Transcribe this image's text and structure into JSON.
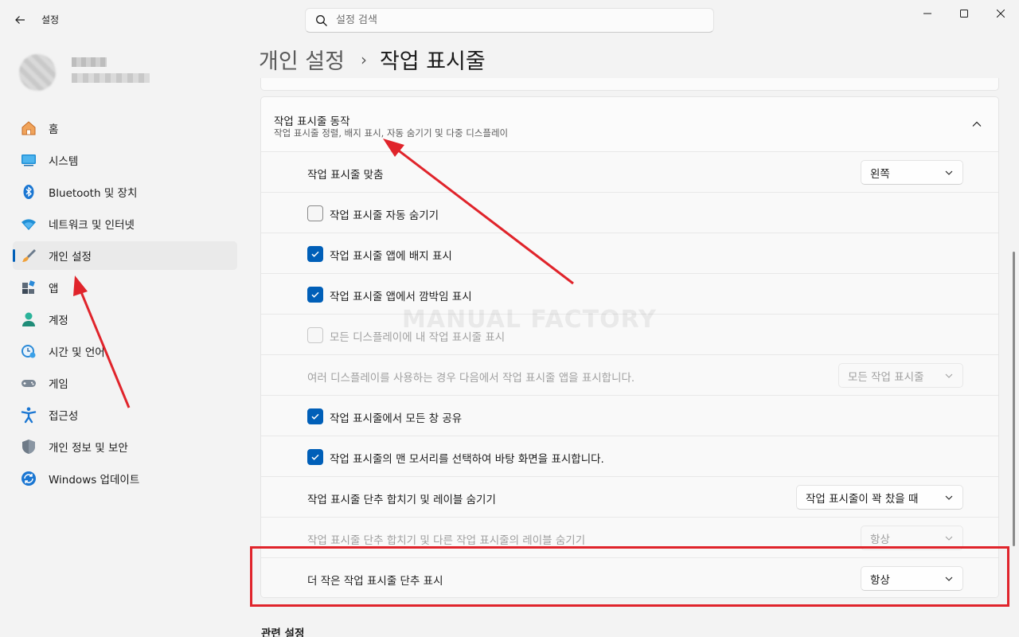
{
  "window": {
    "title": "설정",
    "controls": [
      "minimize",
      "maximize",
      "close"
    ]
  },
  "search": {
    "placeholder": "설정 검색"
  },
  "sidebar": {
    "items": [
      {
        "label": "홈",
        "icon": "home-icon",
        "active": false
      },
      {
        "label": "시스템",
        "icon": "system-icon",
        "active": false
      },
      {
        "label": "Bluetooth 및 장치",
        "icon": "bluetooth-icon",
        "active": false
      },
      {
        "label": "네트워크 및 인터넷",
        "icon": "wifi-icon",
        "active": false
      },
      {
        "label": "개인 설정",
        "icon": "brush-icon",
        "active": true
      },
      {
        "label": "앱",
        "icon": "apps-icon",
        "active": false
      },
      {
        "label": "계정",
        "icon": "account-icon",
        "active": false
      },
      {
        "label": "시간 및 언어",
        "icon": "time-language-icon",
        "active": false
      },
      {
        "label": "게임",
        "icon": "gamepad-icon",
        "active": false
      },
      {
        "label": "접근성",
        "icon": "accessibility-icon",
        "active": false
      },
      {
        "label": "개인 정보 및 보안",
        "icon": "shield-icon",
        "active": false
      },
      {
        "label": "Windows 업데이트",
        "icon": "update-icon",
        "active": false
      }
    ]
  },
  "breadcrumb": {
    "parent": "개인 설정",
    "separator": "›",
    "current": "작업 표시줄"
  },
  "section": {
    "title": "작업 표시줄 동작",
    "subtitle": "작업 표시줄 정렬, 배지 표시, 자동 숨기기 및 다중 디스플레이",
    "rows": [
      {
        "type": "dropdown",
        "label": "작업 표시줄 맞춤",
        "value": "왼쪽",
        "disabled": false
      },
      {
        "type": "checkbox",
        "label": "작업 표시줄 자동 숨기기",
        "checked": false,
        "disabled": false
      },
      {
        "type": "checkbox",
        "label": "작업 표시줄 앱에 배지 표시",
        "checked": true,
        "disabled": false
      },
      {
        "type": "checkbox",
        "label": "작업 표시줄 앱에서 깜박임 표시",
        "checked": true,
        "disabled": false
      },
      {
        "type": "checkbox",
        "label": "모든 디스플레이에 내 작업 표시줄 표시",
        "checked": false,
        "disabled": true
      },
      {
        "type": "dropdown",
        "label": "여러 디스플레이를 사용하는 경우 다음에서 작업 표시줄 앱을 표시합니다.",
        "value": "모든 작업 표시줄",
        "disabled": true
      },
      {
        "type": "checkbox",
        "label": "작업 표시줄에서 모든 창 공유",
        "checked": true,
        "disabled": false
      },
      {
        "type": "checkbox",
        "label": "작업 표시줄의 맨 모서리를 선택하여 바탕 화면을 표시합니다.",
        "checked": true,
        "disabled": false
      },
      {
        "type": "dropdown",
        "label": "작업 표시줄 단추 합치기 및 레이블 숨기기",
        "value": "작업 표시줄이 꽉 찼을 때",
        "disabled": false
      },
      {
        "type": "dropdown",
        "label": "작업 표시줄 단추 합치기 및 다른 작업 표시줄의 레이블 숨기기",
        "value": "항상",
        "disabled": true
      },
      {
        "type": "dropdown",
        "label": "더 작은 작업 표시줄 단추 표시",
        "value": "항상",
        "disabled": false
      }
    ]
  },
  "related": {
    "title": "관련 설정"
  },
  "watermark": "MANUAL FACTORY",
  "colors": {
    "accent": "#005fb8",
    "annotation": "#e0242b"
  }
}
